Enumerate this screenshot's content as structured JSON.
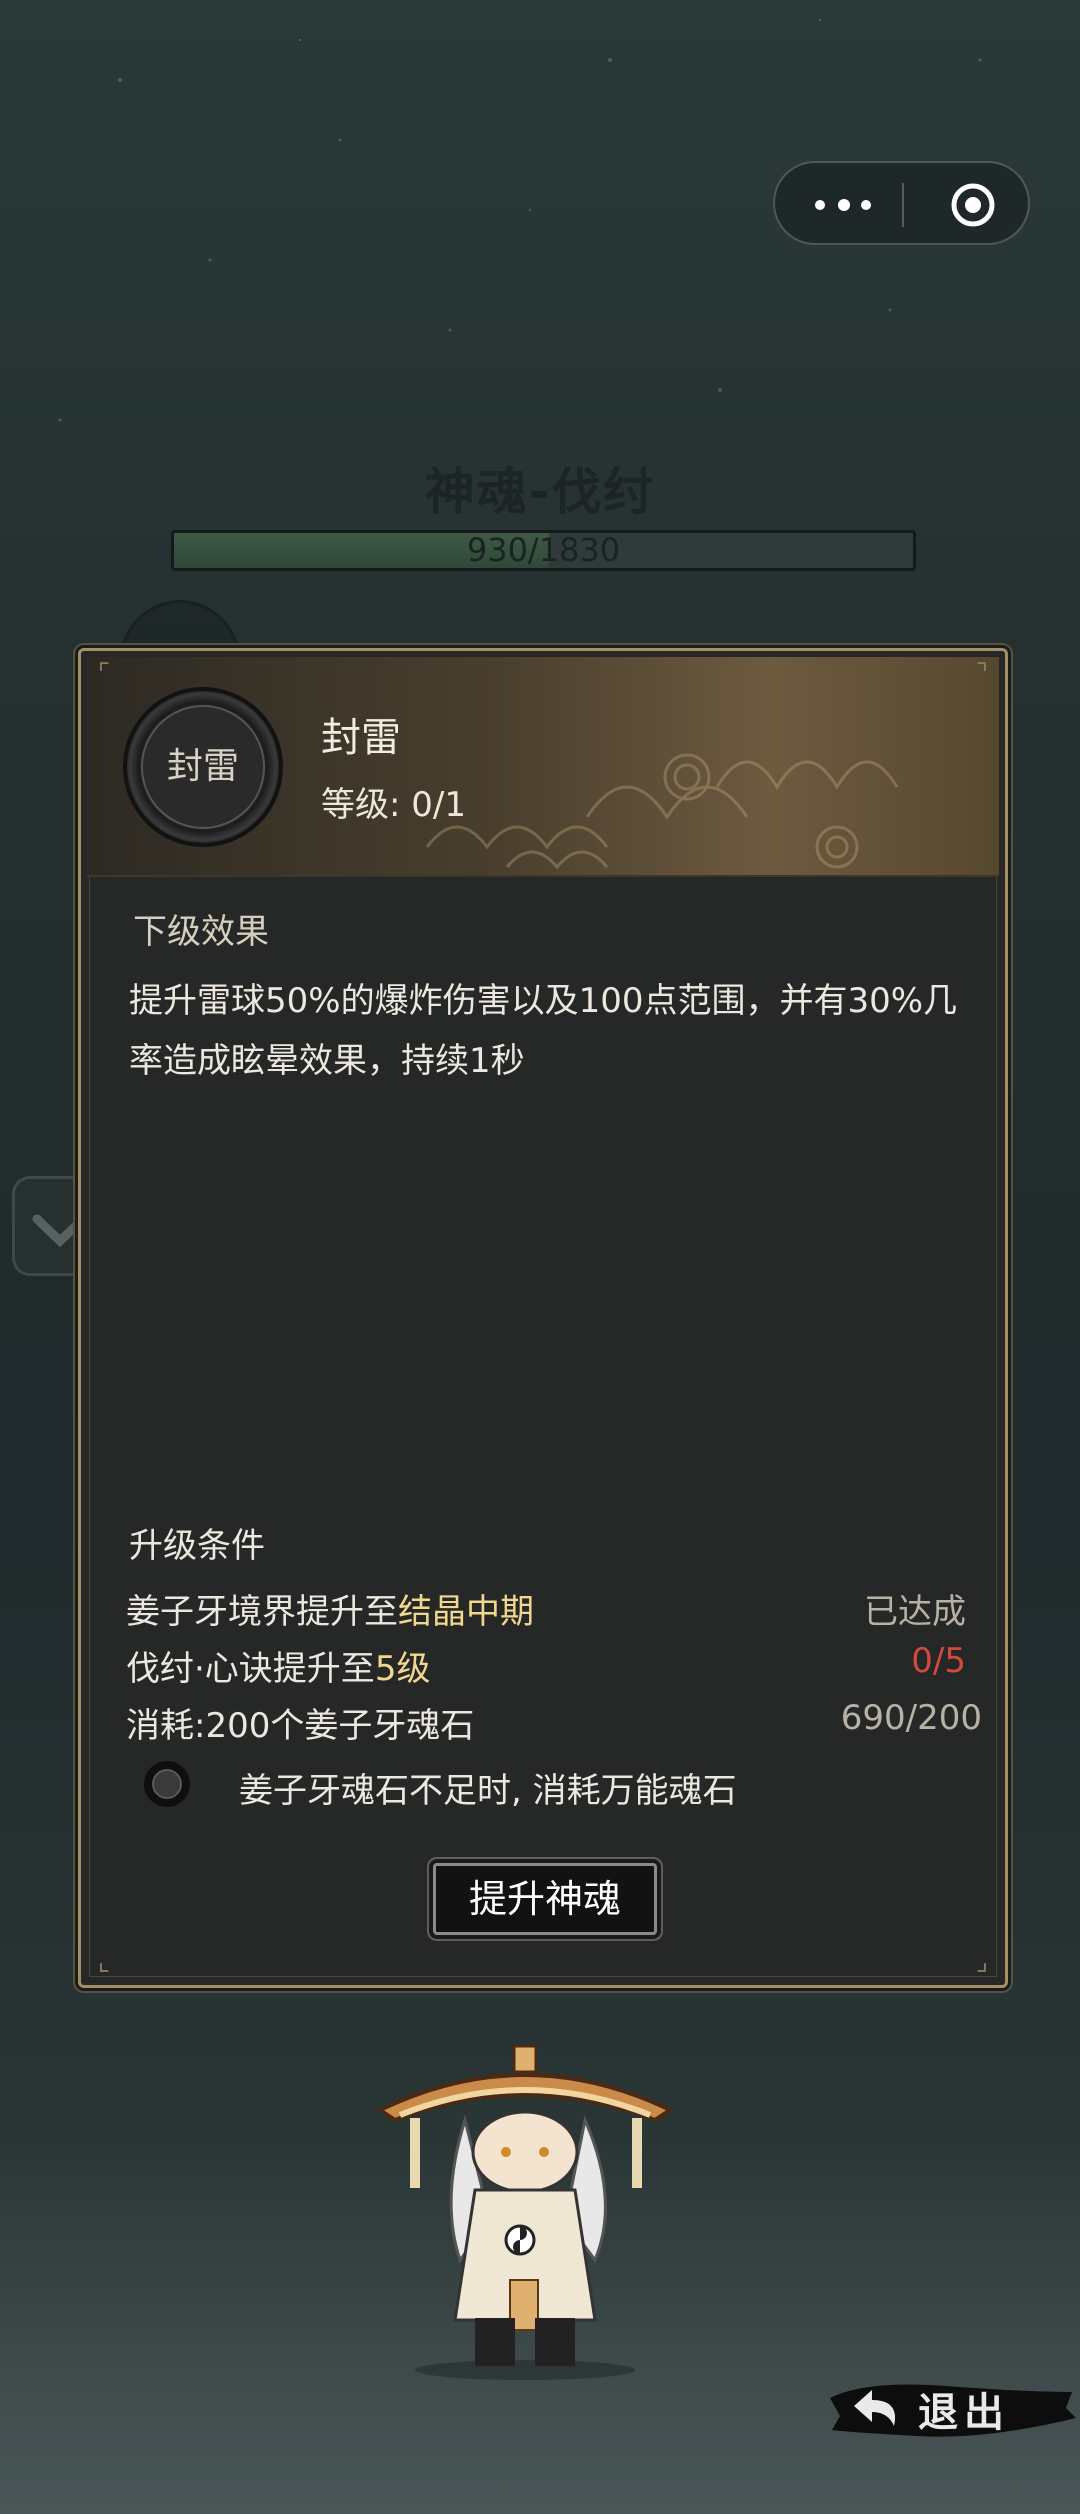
{
  "top": {
    "title": "神魂-伐纣",
    "exp_text": "930/1830",
    "exp_fraction": 0.508
  },
  "skill": {
    "icon_label": "封雷",
    "name": "封雷",
    "level_text": "等级: 0/1"
  },
  "next_effect": {
    "heading": "下级效果",
    "description": "提升雷球50%的爆炸伤害以及100点范围，并有30%几率造成眩晕效果，持续1秒"
  },
  "conditions": {
    "heading": "升级条件",
    "rows": [
      {
        "prefix": "姜子牙境界提升至",
        "highlight": "结晶中期",
        "status": "已达成"
      },
      {
        "prefix": "伐纣·心诀提升至",
        "highlight": "5级",
        "status": "0/5"
      },
      {
        "prefix": "消耗:200个姜子牙魂石",
        "highlight": "",
        "status": "690/200"
      }
    ],
    "toggle_label": "姜子牙魂石不足时, 消耗万能魂石",
    "toggle_on": false
  },
  "buttons": {
    "upgrade": "提升神魂",
    "exit": "退出"
  },
  "icons": {
    "more": "more-dots-icon",
    "target": "target-icon",
    "exit_arrow": "back-arrow-icon",
    "side_tab": "chevron-down-icon"
  },
  "colors": {
    "highlight": "#f0d98c",
    "unmet": "#d04a3e",
    "panel_border": "#a28f66"
  }
}
